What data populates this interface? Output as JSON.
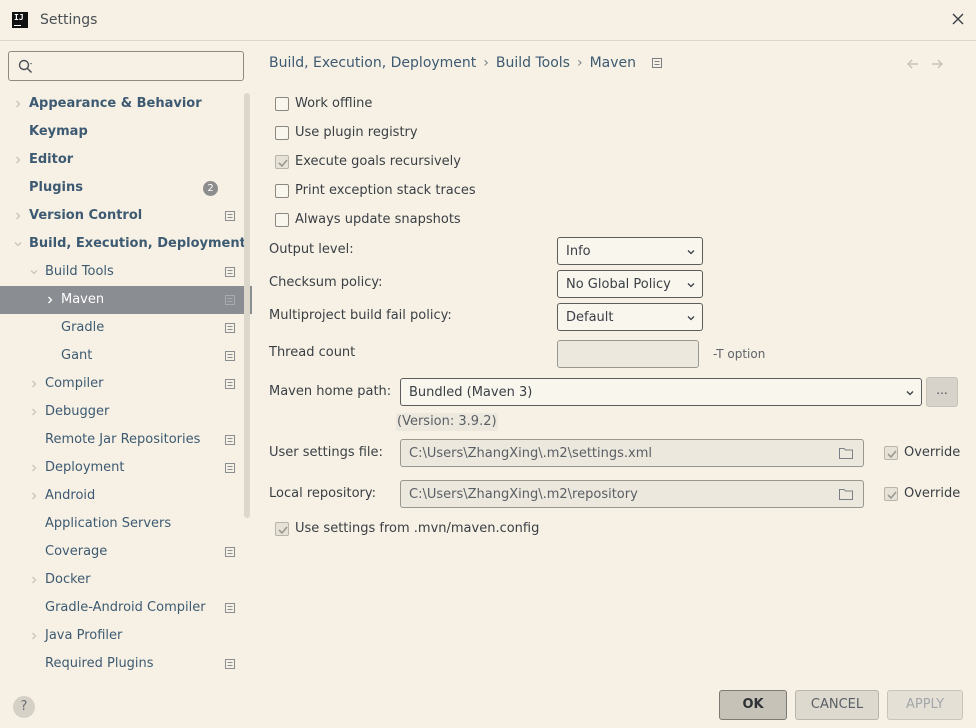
{
  "window": {
    "title": "Settings"
  },
  "search": {
    "placeholder": ""
  },
  "sidebar": {
    "items": [
      {
        "label": "Appearance & Behavior",
        "level": 0,
        "expander": "collapsed",
        "project_icon": false
      },
      {
        "label": "Keymap",
        "level": 0,
        "expander": "none",
        "project_icon": false
      },
      {
        "label": "Editor",
        "level": 0,
        "expander": "collapsed",
        "project_icon": false
      },
      {
        "label": "Plugins",
        "level": 0,
        "expander": "none",
        "project_icon": false,
        "badge": "2"
      },
      {
        "label": "Version Control",
        "level": 0,
        "expander": "collapsed",
        "project_icon": true
      },
      {
        "label": "Build, Execution, Deployment",
        "level": 0,
        "expander": "expanded",
        "project_icon": false
      },
      {
        "label": "Build Tools",
        "level": 1,
        "expander": "expanded",
        "project_icon": true
      },
      {
        "label": "Maven",
        "level": 2,
        "expander": "collapsed",
        "project_icon": true,
        "selected": true
      },
      {
        "label": "Gradle",
        "level": 2,
        "expander": "none",
        "project_icon": true
      },
      {
        "label": "Gant",
        "level": 2,
        "expander": "none",
        "project_icon": true
      },
      {
        "label": "Compiler",
        "level": 1,
        "expander": "collapsed",
        "project_icon": true
      },
      {
        "label": "Debugger",
        "level": 1,
        "expander": "collapsed",
        "project_icon": false
      },
      {
        "label": "Remote Jar Repositories",
        "level": 1,
        "expander": "none",
        "project_icon": true
      },
      {
        "label": "Deployment",
        "level": 1,
        "expander": "collapsed",
        "project_icon": true
      },
      {
        "label": "Android",
        "level": 1,
        "expander": "collapsed",
        "project_icon": false
      },
      {
        "label": "Application Servers",
        "level": 1,
        "expander": "none",
        "project_icon": false
      },
      {
        "label": "Coverage",
        "level": 1,
        "expander": "none",
        "project_icon": true
      },
      {
        "label": "Docker",
        "level": 1,
        "expander": "collapsed",
        "project_icon": false
      },
      {
        "label": "Gradle-Android Compiler",
        "level": 1,
        "expander": "none",
        "project_icon": true
      },
      {
        "label": "Java Profiler",
        "level": 1,
        "expander": "collapsed",
        "project_icon": false
      },
      {
        "label": "Required Plugins",
        "level": 1,
        "expander": "none",
        "project_icon": true
      }
    ]
  },
  "breadcrumb": {
    "parts": [
      "Build, Execution, Deployment",
      "Build Tools",
      "Maven"
    ],
    "separator": "›"
  },
  "options": {
    "work_offline": {
      "label": "Work offline",
      "checked": false
    },
    "use_plugin_registry": {
      "label": "Use plugin registry",
      "checked": false
    },
    "execute_goals_recursively": {
      "label": "Execute goals recursively",
      "checked": true
    },
    "print_exception_stack_traces": {
      "label": "Print exception stack traces",
      "checked": false
    },
    "always_update_snapshots": {
      "label": "Always update snapshots",
      "checked": false
    }
  },
  "form": {
    "output_level": {
      "label": "Output level:",
      "value": "Info"
    },
    "checksum_policy": {
      "label": "Checksum policy:",
      "value": "No Global Policy"
    },
    "multiproject_fail_policy": {
      "label": "Multiproject build fail policy:",
      "value": "Default"
    },
    "thread_count": {
      "label": "Thread count",
      "value": "",
      "hint": "-T option"
    },
    "maven_home": {
      "label": "Maven home path:",
      "value": "Bundled (Maven 3)",
      "browse_label": "...",
      "version_note": "(Version: 3.9.2)"
    },
    "user_settings": {
      "label": "User settings file:",
      "value": "C:\\Users\\ZhangXing\\.m2\\settings.xml",
      "override_label": "Override",
      "override_checked": true
    },
    "local_repository": {
      "label": "Local repository:",
      "value": "C:\\Users\\ZhangXing\\.m2\\repository",
      "override_label": "Override",
      "override_checked": true
    },
    "use_mvn_config": {
      "label": "Use settings from .mvn/maven.config",
      "checked": true
    }
  },
  "footer": {
    "help_label": "?",
    "ok_label": "OK",
    "cancel_label": "CANCEL",
    "apply_label": "APPLY"
  },
  "colors": {
    "background": "#f6f1e4",
    "tree_text": "#3d5a72",
    "selection": "#8a8d92"
  }
}
